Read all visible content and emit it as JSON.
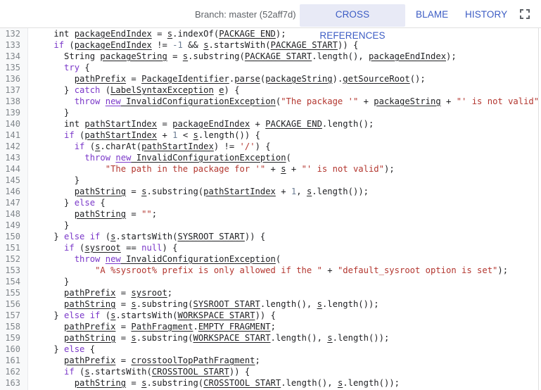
{
  "header": {
    "branch_label": "Branch: master (52aff7d)",
    "tabs": [
      {
        "label": "CROSS REFERENCES",
        "active": true
      },
      {
        "label": "BLAME",
        "active": false
      },
      {
        "label": "HISTORY",
        "active": false
      }
    ],
    "fullscreen_icon": "fullscreen-icon"
  },
  "colors": {
    "accent": "#3c5cc4",
    "active_tab_bg": "#e8eaf6",
    "keyword": "#7b38c9",
    "string": "#b3362f",
    "number": "#6b7c93",
    "text": "#202124",
    "line_number": "#80868b"
  },
  "code": {
    "lines": [
      {
        "n": "132",
        "t": [
          [
            "p",
            "    "
          ],
          [
            "p",
            "int "
          ],
          [
            "r",
            "packageEndIndex"
          ],
          [
            "p",
            " = "
          ],
          [
            "r",
            "s"
          ],
          [
            "p",
            ".indexOf("
          ],
          [
            "r",
            "PACKAGE_END"
          ],
          [
            "p",
            ");"
          ]
        ]
      },
      {
        "n": "133",
        "t": [
          [
            "p",
            "    "
          ],
          [
            "k",
            "if"
          ],
          [
            "p",
            " ("
          ],
          [
            "r",
            "packageEndIndex"
          ],
          [
            "p",
            " != "
          ],
          [
            "n",
            "-1"
          ],
          [
            "p",
            " && "
          ],
          [
            "r",
            "s"
          ],
          [
            "p",
            ".startsWith("
          ],
          [
            "r",
            "PACKAGE_START"
          ],
          [
            "p",
            ")) {"
          ]
        ]
      },
      {
        "n": "134",
        "t": [
          [
            "p",
            "      String "
          ],
          [
            "r",
            "packageString"
          ],
          [
            "p",
            " = "
          ],
          [
            "r",
            "s"
          ],
          [
            "p",
            ".substring("
          ],
          [
            "r",
            "PACKAGE_START"
          ],
          [
            "p",
            ".length(), "
          ],
          [
            "r",
            "packageEndIndex"
          ],
          [
            "p",
            ");"
          ]
        ]
      },
      {
        "n": "135",
        "t": [
          [
            "p",
            "      "
          ],
          [
            "k",
            "try"
          ],
          [
            "p",
            " {"
          ]
        ]
      },
      {
        "n": "136",
        "t": [
          [
            "p",
            "        "
          ],
          [
            "r",
            "pathPrefix"
          ],
          [
            "p",
            " = "
          ],
          [
            "r",
            "PackageIdentifier"
          ],
          [
            "p",
            "."
          ],
          [
            "r",
            "parse"
          ],
          [
            "p",
            "("
          ],
          [
            "r",
            "packageString"
          ],
          [
            "p",
            ")."
          ],
          [
            "r",
            "getSourceRoot"
          ],
          [
            "p",
            "();"
          ]
        ]
      },
      {
        "n": "137",
        "t": [
          [
            "p",
            "      } "
          ],
          [
            "k",
            "catch"
          ],
          [
            "p",
            " ("
          ],
          [
            "r",
            "LabelSyntaxException"
          ],
          [
            "p",
            " "
          ],
          [
            "r",
            "e"
          ],
          [
            "p",
            ") {"
          ]
        ]
      },
      {
        "n": "138",
        "t": [
          [
            "p",
            "        "
          ],
          [
            "k",
            "throw "
          ],
          [
            "rk",
            "new"
          ],
          [
            "r",
            " InvalidConfigurationException"
          ],
          [
            "p",
            "("
          ],
          [
            "s",
            "\"The package '\""
          ],
          [
            "p",
            " + "
          ],
          [
            "r",
            "packageString"
          ],
          [
            "p",
            " + "
          ],
          [
            "s",
            "\"' is not valid\""
          ],
          [
            "p",
            ")"
          ]
        ]
      },
      {
        "n": "139",
        "t": [
          [
            "p",
            "      }"
          ]
        ]
      },
      {
        "n": "140",
        "t": [
          [
            "p",
            "      int "
          ],
          [
            "r",
            "pathStartIndex"
          ],
          [
            "p",
            " = "
          ],
          [
            "r",
            "packageEndIndex"
          ],
          [
            "p",
            " + "
          ],
          [
            "r",
            "PACKAGE_END"
          ],
          [
            "p",
            ".length();"
          ]
        ]
      },
      {
        "n": "141",
        "t": [
          [
            "p",
            "      "
          ],
          [
            "k",
            "if"
          ],
          [
            "p",
            " ("
          ],
          [
            "r",
            "pathStartIndex"
          ],
          [
            "p",
            " + "
          ],
          [
            "n",
            "1"
          ],
          [
            "p",
            " < "
          ],
          [
            "r",
            "s"
          ],
          [
            "p",
            ".length()) {"
          ]
        ]
      },
      {
        "n": "142",
        "t": [
          [
            "p",
            "        "
          ],
          [
            "k",
            "if"
          ],
          [
            "p",
            " ("
          ],
          [
            "r",
            "s"
          ],
          [
            "p",
            ".charAt("
          ],
          [
            "r",
            "pathStartIndex"
          ],
          [
            "p",
            ") != "
          ],
          [
            "s",
            "'/'"
          ],
          [
            "p",
            ") {"
          ]
        ]
      },
      {
        "n": "143",
        "t": [
          [
            "p",
            "          "
          ],
          [
            "k",
            "throw "
          ],
          [
            "rk",
            "new"
          ],
          [
            "r",
            " InvalidConfigurationException"
          ],
          [
            "p",
            "("
          ]
        ]
      },
      {
        "n": "144",
        "t": [
          [
            "p",
            "              "
          ],
          [
            "s",
            "\"The path in the package for '\""
          ],
          [
            "p",
            " + "
          ],
          [
            "r",
            "s"
          ],
          [
            "p",
            " + "
          ],
          [
            "s",
            "\"' is not valid\""
          ],
          [
            "p",
            ");"
          ]
        ]
      },
      {
        "n": "145",
        "t": [
          [
            "p",
            "        }"
          ]
        ]
      },
      {
        "n": "146",
        "t": [
          [
            "p",
            "        "
          ],
          [
            "r",
            "pathString"
          ],
          [
            "p",
            " = "
          ],
          [
            "r",
            "s"
          ],
          [
            "p",
            ".substring("
          ],
          [
            "r",
            "pathStartIndex"
          ],
          [
            "p",
            " + "
          ],
          [
            "n",
            "1"
          ],
          [
            "p",
            ", "
          ],
          [
            "r",
            "s"
          ],
          [
            "p",
            ".length());"
          ]
        ]
      },
      {
        "n": "147",
        "t": [
          [
            "p",
            "      } "
          ],
          [
            "k",
            "else"
          ],
          [
            "p",
            " {"
          ]
        ]
      },
      {
        "n": "148",
        "t": [
          [
            "p",
            "        "
          ],
          [
            "r",
            "pathString"
          ],
          [
            "p",
            " = "
          ],
          [
            "s",
            "\"\""
          ],
          [
            "p",
            ";"
          ]
        ]
      },
      {
        "n": "149",
        "t": [
          [
            "p",
            "      }"
          ]
        ]
      },
      {
        "n": "150",
        "t": [
          [
            "p",
            "    } "
          ],
          [
            "k",
            "else if"
          ],
          [
            "p",
            " ("
          ],
          [
            "r",
            "s"
          ],
          [
            "p",
            ".startsWith("
          ],
          [
            "r",
            "SYSROOT_START"
          ],
          [
            "p",
            ")) {"
          ]
        ]
      },
      {
        "n": "151",
        "t": [
          [
            "p",
            "      "
          ],
          [
            "k",
            "if"
          ],
          [
            "p",
            " ("
          ],
          [
            "r",
            "sysroot"
          ],
          [
            "p",
            " == "
          ],
          [
            "k",
            "null"
          ],
          [
            "p",
            ") {"
          ]
        ]
      },
      {
        "n": "152",
        "t": [
          [
            "p",
            "        "
          ],
          [
            "k",
            "throw "
          ],
          [
            "rk",
            "new"
          ],
          [
            "r",
            " InvalidConfigurationException"
          ],
          [
            "p",
            "("
          ]
        ]
      },
      {
        "n": "153",
        "t": [
          [
            "p",
            "            "
          ],
          [
            "s",
            "\"A %sysroot% prefix is only allowed if the \""
          ],
          [
            "p",
            " + "
          ],
          [
            "s",
            "\"default_sysroot option is set\""
          ],
          [
            "p",
            ");"
          ]
        ]
      },
      {
        "n": "154",
        "t": [
          [
            "p",
            "      }"
          ]
        ]
      },
      {
        "n": "155",
        "t": [
          [
            "p",
            "      "
          ],
          [
            "r",
            "pathPrefix"
          ],
          [
            "p",
            " = "
          ],
          [
            "r",
            "sysroot"
          ],
          [
            "p",
            ";"
          ]
        ]
      },
      {
        "n": "156",
        "t": [
          [
            "p",
            "      "
          ],
          [
            "r",
            "pathString"
          ],
          [
            "p",
            " = "
          ],
          [
            "r",
            "s"
          ],
          [
            "p",
            ".substring("
          ],
          [
            "r",
            "SYSROOT_START"
          ],
          [
            "p",
            ".length(), "
          ],
          [
            "r",
            "s"
          ],
          [
            "p",
            ".length());"
          ]
        ]
      },
      {
        "n": "157",
        "t": [
          [
            "p",
            "    } "
          ],
          [
            "k",
            "else if"
          ],
          [
            "p",
            " ("
          ],
          [
            "r",
            "s"
          ],
          [
            "p",
            ".startsWith("
          ],
          [
            "r",
            "WORKSPACE_START"
          ],
          [
            "p",
            ")) {"
          ]
        ]
      },
      {
        "n": "158",
        "t": [
          [
            "p",
            "      "
          ],
          [
            "r",
            "pathPrefix"
          ],
          [
            "p",
            " = "
          ],
          [
            "r",
            "PathFragment"
          ],
          [
            "p",
            "."
          ],
          [
            "r",
            "EMPTY_FRAGMENT"
          ],
          [
            "p",
            ";"
          ]
        ]
      },
      {
        "n": "159",
        "t": [
          [
            "p",
            "      "
          ],
          [
            "r",
            "pathString"
          ],
          [
            "p",
            " = "
          ],
          [
            "r",
            "s"
          ],
          [
            "p",
            ".substring("
          ],
          [
            "r",
            "WORKSPACE_START"
          ],
          [
            "p",
            ".length(), "
          ],
          [
            "r",
            "s"
          ],
          [
            "p",
            ".length());"
          ]
        ]
      },
      {
        "n": "160",
        "t": [
          [
            "p",
            "    } "
          ],
          [
            "k",
            "else"
          ],
          [
            "p",
            " {"
          ]
        ]
      },
      {
        "n": "161",
        "t": [
          [
            "p",
            "      "
          ],
          [
            "r",
            "pathPrefix"
          ],
          [
            "p",
            " = "
          ],
          [
            "r",
            "crosstoolTopPathFragment"
          ],
          [
            "p",
            ";"
          ]
        ]
      },
      {
        "n": "162",
        "t": [
          [
            "p",
            "      "
          ],
          [
            "k",
            "if"
          ],
          [
            "p",
            " ("
          ],
          [
            "r",
            "s"
          ],
          [
            "p",
            ".startsWith("
          ],
          [
            "r",
            "CROSSTOOL_START"
          ],
          [
            "p",
            ")) {"
          ]
        ]
      },
      {
        "n": "163",
        "t": [
          [
            "p",
            "        "
          ],
          [
            "r",
            "pathString"
          ],
          [
            "p",
            " = "
          ],
          [
            "r",
            "s"
          ],
          [
            "p",
            ".substring("
          ],
          [
            "r",
            "CROSSTOOL_START"
          ],
          [
            "p",
            ".length(), "
          ],
          [
            "r",
            "s"
          ],
          [
            "p",
            ".length());"
          ]
        ]
      }
    ]
  }
}
